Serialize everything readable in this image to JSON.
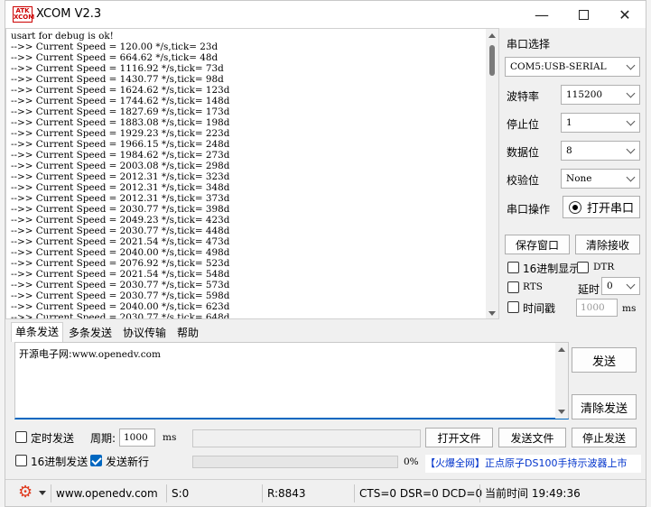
{
  "window": {
    "title": "XCOM V2.3",
    "logo_text": "ATK XCOM",
    "minimize_label": "—",
    "close_label": "✕"
  },
  "receive": {
    "lines": "usart for debug is ok!\n-->> Current Speed = 120.00 */s,tick= 23d\n-->> Current Speed = 664.62 */s,tick= 48d\n-->> Current Speed = 1116.92 */s,tick= 73d\n-->> Current Speed = 1430.77 */s,tick= 98d\n-->> Current Speed = 1624.62 */s,tick= 123d\n-->> Current Speed = 1744.62 */s,tick= 148d\n-->> Current Speed = 1827.69 */s,tick= 173d\n-->> Current Speed = 1883.08 */s,tick= 198d\n-->> Current Speed = 1929.23 */s,tick= 223d\n-->> Current Speed = 1966.15 */s,tick= 248d\n-->> Current Speed = 1984.62 */s,tick= 273d\n-->> Current Speed = 2003.08 */s,tick= 298d\n-->> Current Speed = 2012.31 */s,tick= 323d\n-->> Current Speed = 2012.31 */s,tick= 348d\n-->> Current Speed = 2012.31 */s,tick= 373d\n-->> Current Speed = 2030.77 */s,tick= 398d\n-->> Current Speed = 2049.23 */s,tick= 423d\n-->> Current Speed = 2030.77 */s,tick= 448d\n-->> Current Speed = 2021.54 */s,tick= 473d\n-->> Current Speed = 2040.00 */s,tick= 498d\n-->> Current Speed = 2076.92 */s,tick= 523d\n-->> Current Speed = 2021.54 */s,tick= 548d\n-->> Current Speed = 2030.77 */s,tick= 573d\n-->> Current Speed = 2030.77 */s,tick= 598d\n-->> Current Speed = 2040.00 */s,tick= 623d\n-->> Current Speed = 2030.77 */s,tick= 648d"
  },
  "settings": {
    "port_label": "串口选择",
    "port_value": "COM5:USB-SERIAL",
    "baud_label": "波特率",
    "baud_value": "115200",
    "stopbits_label": "停止位",
    "stopbits_value": "1",
    "databits_label": "数据位",
    "databits_value": "8",
    "parity_label": "校验位",
    "parity_value": "None",
    "operation_label": "串口操作",
    "open_port_button": "打开串口",
    "save_window_button": "保存窗口",
    "clear_receive_button": "清除接收",
    "hex_display_label": "16进制显示",
    "dtr_label": "DTR",
    "rts_label": "RTS",
    "delay_label": "延时",
    "delay_value": "0",
    "timestamp_label": "时间戳",
    "timestamp_value": "1000",
    "timestamp_unit": "ms"
  },
  "tabs": [
    {
      "label": "单条发送"
    },
    {
      "label": "多条发送"
    },
    {
      "label": "协议传输"
    },
    {
      "label": "帮助"
    }
  ],
  "send": {
    "text_cn": "开源电子网:",
    "text_url": "www.openedv.com",
    "send_button": "发送",
    "clear_send_button": "清除发送",
    "timed_send_label": "定时发送",
    "period_label": "周期:",
    "period_value": "1000",
    "period_unit": "ms",
    "open_file_button": "打开文件",
    "send_file_button": "发送文件",
    "stop_send_button": "停止发送",
    "hex_send_label": "16进制发送",
    "send_newline_label": "发送新行",
    "progress_text": "0%",
    "progress_fraction": 0
  },
  "ad": {
    "text": "【火爆全网】正点原子DS100手持示波器上市"
  },
  "status": {
    "website": "www.openedv.com",
    "sent": "S:0",
    "received": "R:8843",
    "lines": "CTS=0 DSR=0 DCD=0",
    "time": "当前时间 19:49:36"
  },
  "icons": {
    "settings": "gear-icon",
    "dropdown": "chevron-down-icon"
  }
}
